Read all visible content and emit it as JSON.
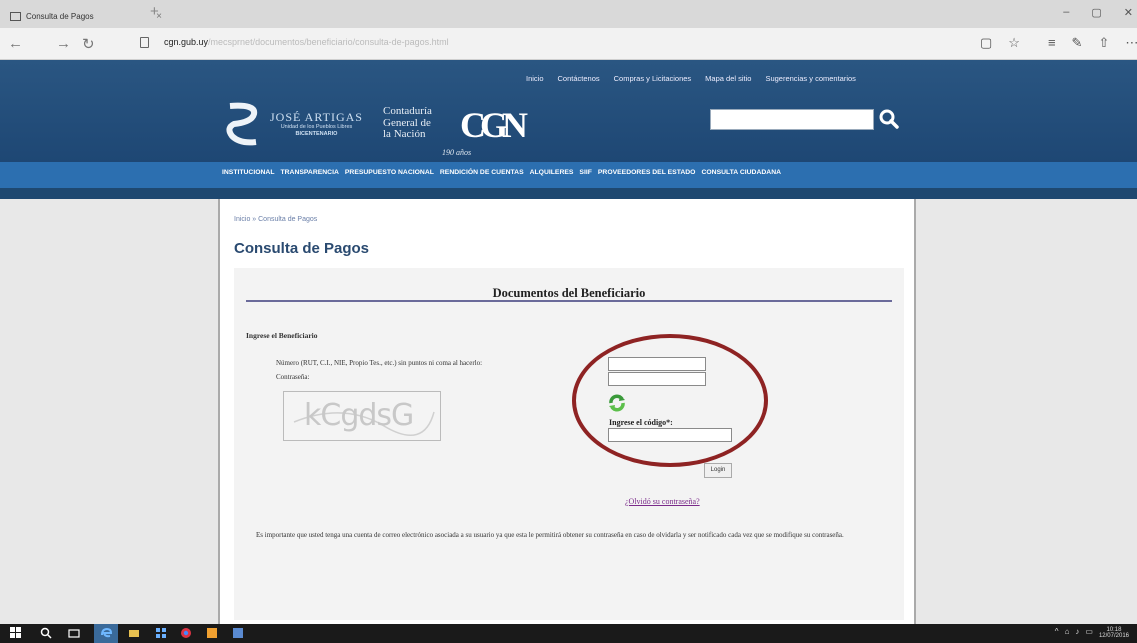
{
  "browser": {
    "tab_title": "Consulta de Pagos",
    "tab_close": "×",
    "new_tab": "+",
    "window_controls": [
      "–",
      "▢",
      "✕"
    ],
    "url_host": "cgn.gub.uy",
    "url_path": "/mecsprnet/documentos/beneficiario/consulta-de-pagos.html",
    "nav": {
      "back": "←",
      "forward": "→",
      "refresh": "↻"
    },
    "right_tools": [
      "▢",
      "☆",
      "≡",
      "✎",
      "⇧",
      "⋯"
    ]
  },
  "site": {
    "top_links": [
      "Inicio",
      "Contáctenos",
      "Compras y Licitaciones",
      "Mapa del sitio",
      "Sugerencias y comentarios"
    ],
    "artigas_title": "JOSÉ ARTIGAS",
    "artigas_sub1": "Unidad de los Pueblos Libres",
    "artigas_sub2": "BICENTENARIO",
    "cgn_line1": "Contaduría",
    "cgn_line2": "General de",
    "cgn_line3": "la Nación",
    "cgn_mark": "CGN",
    "anios": "190 años",
    "search_placeholder": "",
    "menu": [
      "INSTITUCIONAL",
      "TRANSPARENCIA",
      "PRESUPUESTO NACIONAL",
      "RENDICIÓN DE CUENTAS",
      "ALQUILERES",
      "SIIF",
      "PROVEEDORES DEL ESTADO",
      "CONSULTA CIUDADANA"
    ]
  },
  "page": {
    "breadcrumb": "Inicio  »  Consulta de Pagos",
    "title": "Consulta de Pagos",
    "doc_title": "Documentos del Beneficiario",
    "section_label": "Ingrese el Beneficiario",
    "label_number": "Número (RUT, C.I., NIE, Propio Tes., etc.) sin puntos ni coma al hacerlo:",
    "label_password": "Contraseña:",
    "captcha_text": "kCgdsG",
    "label_code": "Ingrese el código*:",
    "login_button": "Login",
    "forgot_link": "¿Olvidó su contraseña?",
    "note": "Es importante que usted tenga una cuenta de correo electrónico asociada a su usuario ya que esta le permitirá obtener su contraseña en caso de olvidarla y ser notificado cada vez que se modifique su contraseña."
  },
  "taskbar": {
    "time": "10:18",
    "date": "12/07/2016"
  },
  "colors": {
    "header_blue": "#1e4870",
    "menu_blue": "#2c6fb0",
    "annotation_red": "#8e2323"
  }
}
